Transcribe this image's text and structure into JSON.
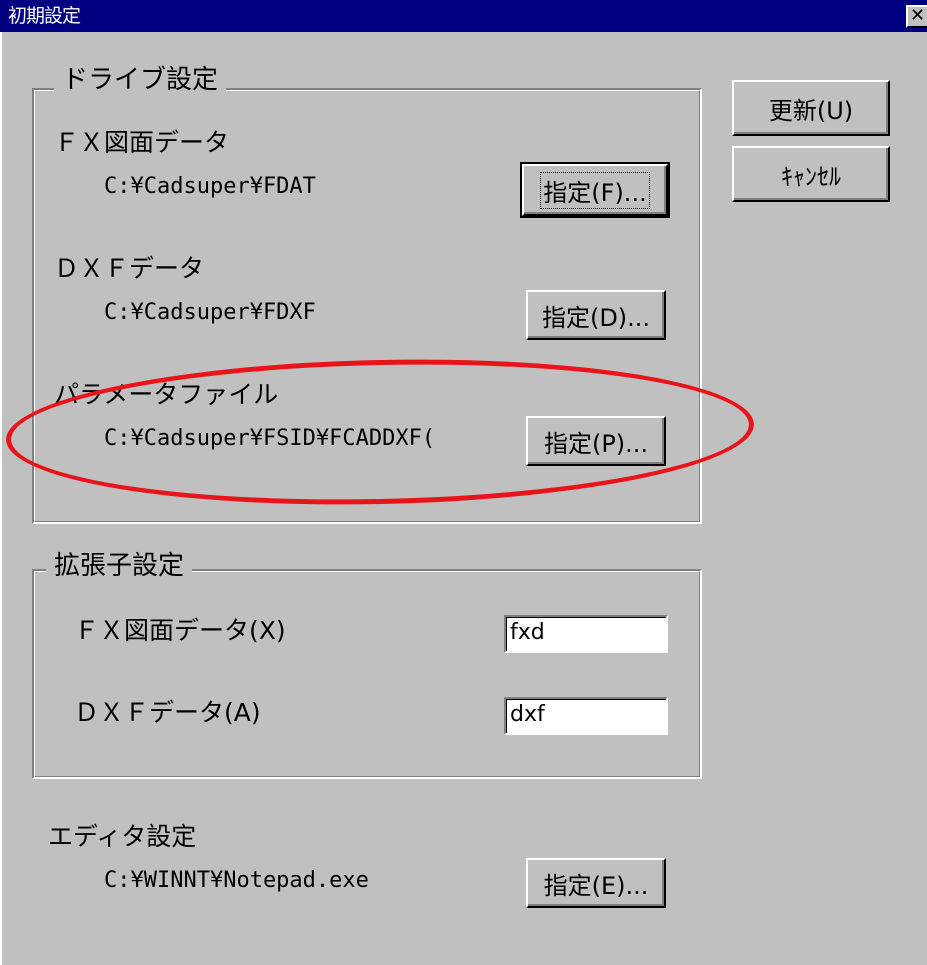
{
  "window": {
    "title": "初期設定",
    "close_glyph": "✕"
  },
  "drive": {
    "legend": "ドライブ設定",
    "fx": {
      "label": "ＦＸ図面データ",
      "path": "C:¥Cadsuper¥FDAT",
      "button": "指定(F)..."
    },
    "dxf": {
      "label": "ＤＸＦデータ",
      "path": "C:¥Cadsuper¥FDXF",
      "button": "指定(D)..."
    },
    "param": {
      "label": "パラメータファイル",
      "path": "C:¥Cadsuper¥FSID¥FCADDXF(",
      "button": "指定(P)..."
    }
  },
  "ext": {
    "legend": "拡張子設定",
    "fx": {
      "label": "ＦＸ図面データ(X)",
      "value": "fxd"
    },
    "dxf": {
      "label": "ＤＸＦデータ(A)",
      "value": "dxf"
    }
  },
  "editor": {
    "label": "エディタ設定",
    "path": "C:¥WINNT¥Notepad.exe",
    "button": "指定(E)..."
  },
  "actions": {
    "update": "更新(U)",
    "cancel": "ｷｬﾝｾﾙ"
  },
  "annotation": {
    "color": "#e8141a"
  }
}
